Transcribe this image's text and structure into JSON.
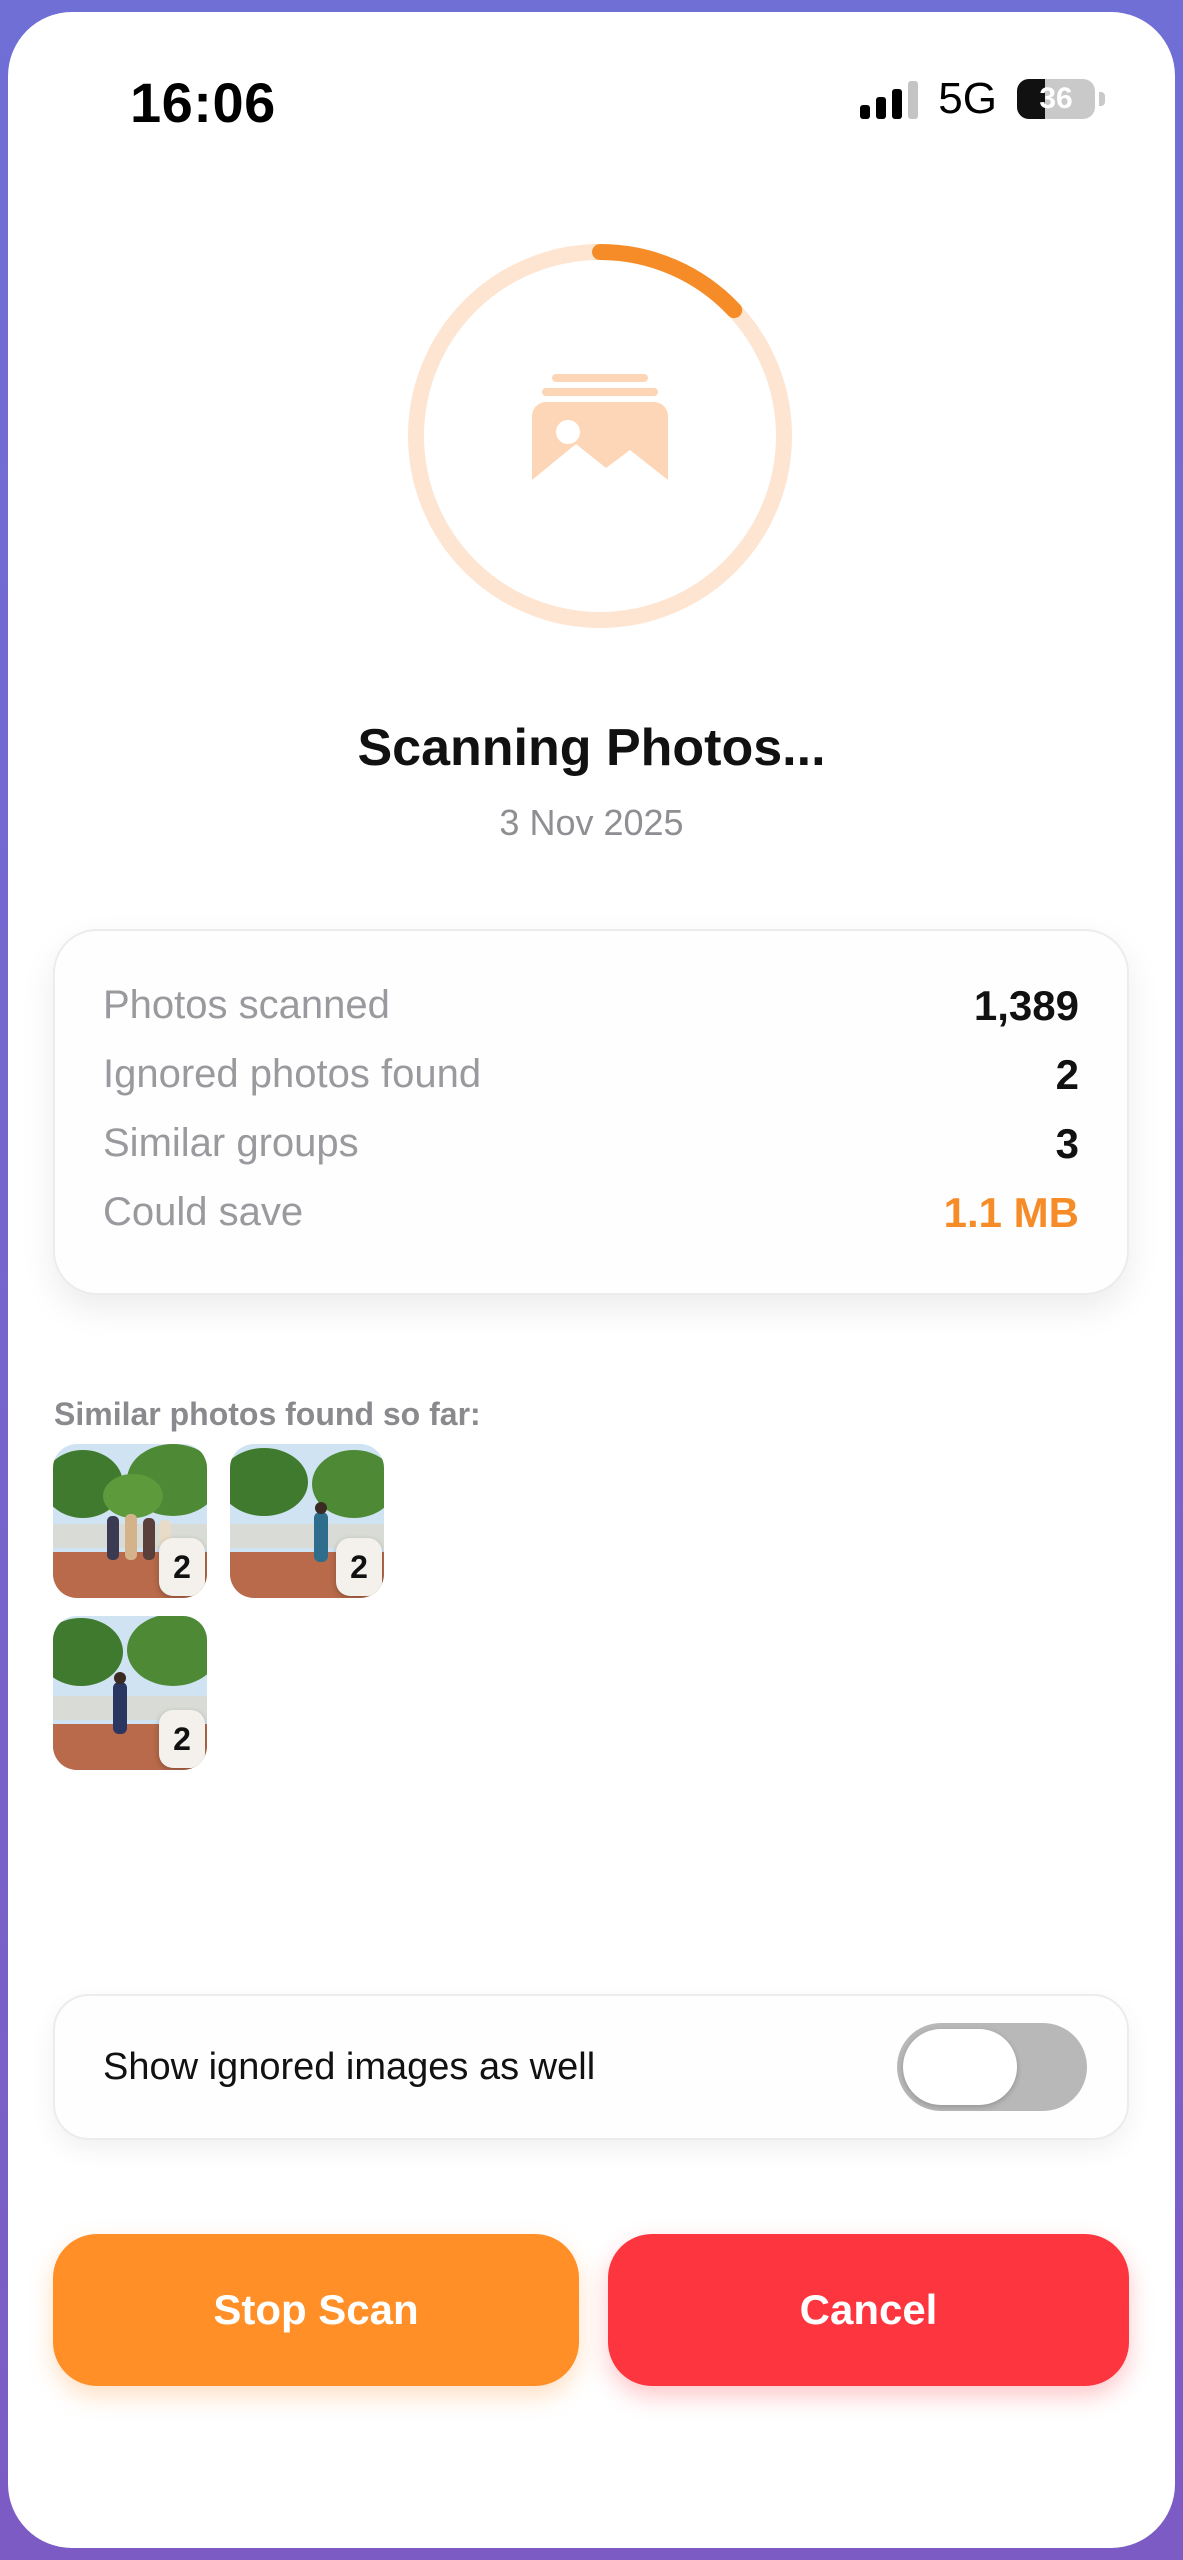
{
  "status_bar": {
    "time": "16:06",
    "network": "5G",
    "battery": "36",
    "battery_level": 0.36
  },
  "scan": {
    "title": "Scanning Photos...",
    "date": "3 Nov 2025",
    "progress": 0.13,
    "icon": "photo-stack-icon",
    "accent_color": "#f68c27",
    "ring_track_color": "#fde5d2"
  },
  "stats": [
    {
      "label": "Photos scanned",
      "value": "1,389"
    },
    {
      "label": "Ignored photos found",
      "value": "2"
    },
    {
      "label": "Similar groups",
      "value": "3"
    },
    {
      "label": "Could save",
      "value": "1.1 MB"
    }
  ],
  "similar": {
    "heading": "Similar photos found so far:",
    "groups": [
      {
        "count": "2"
      },
      {
        "count": "2"
      },
      {
        "count": "2"
      }
    ]
  },
  "toggle": {
    "label": "Show ignored images as well",
    "on": false
  },
  "buttons": {
    "stop": "Stop Scan",
    "cancel": "Cancel",
    "stop_color": "#ff8f26",
    "cancel_color": "#fd353e"
  }
}
